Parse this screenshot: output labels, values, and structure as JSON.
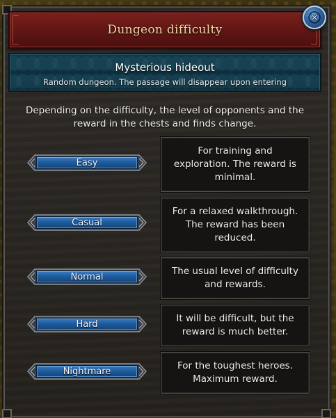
{
  "window": {
    "title": "Dungeon difficulty",
    "close_icon": "close-x-icon"
  },
  "location": {
    "name": "Mysterious hideout",
    "description": "Random dungeon. The passage will disappear upon entering"
  },
  "intro_text": "Depending on the difficulty, the level of opponents and the reward in the chests and finds change.",
  "difficulties": [
    {
      "label": "Easy",
      "description": "For training and exploration. The reward is minimal."
    },
    {
      "label": "Casual",
      "description": "For a relaxed walkthrough. The reward has been reduced."
    },
    {
      "label": "Normal",
      "description": "The usual level of difficulty and rewards."
    },
    {
      "label": "Hard",
      "description": "It will be difficult, but the reward is much better."
    },
    {
      "label": "Nightmare",
      "description": "For the toughest heroes. Maximum reward."
    }
  ],
  "colors": {
    "title_banner": "#6a1a18",
    "location_banner": "#0f3544",
    "button_blue": "#1f5c9e",
    "panel": "#2a2622"
  }
}
